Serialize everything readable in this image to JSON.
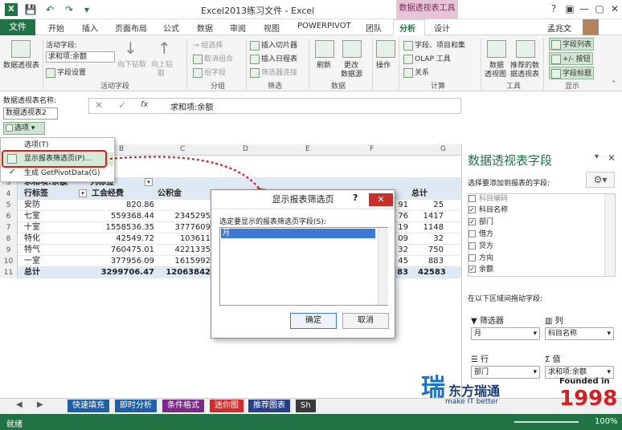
{
  "titlebar": {
    "title": "Excel2013练习文件 - Excel",
    "context_tools": "数据透视表工具",
    "user": "孟兆文"
  },
  "tabs": [
    {
      "label": "文件"
    },
    {
      "label": "开始"
    },
    {
      "label": "插入"
    },
    {
      "label": "页面布局"
    },
    {
      "label": "公式"
    },
    {
      "label": "数据"
    },
    {
      "label": "审阅"
    },
    {
      "label": "视图"
    },
    {
      "label": "POWERPIVOT"
    },
    {
      "label": "团队"
    },
    {
      "label": "分析"
    },
    {
      "label": "设计"
    }
  ],
  "ribbon": {
    "pivot_table_btn": "数据透视表",
    "active_field_label": "活动字段:",
    "active_field_value": "求和项:余额",
    "field_settings": "字段设置",
    "drill_down": "向下钻取",
    "drill_up": "向上钻",
    "drill_up2": "取",
    "group_active_field": "活动字段",
    "group_selection": "→ 组选择",
    "ungroup": "取消组合",
    "group_field": "组字段",
    "group_group": "分组",
    "insert_slicer": "插入切片器",
    "insert_timeline": "插入日程表",
    "filter_connections": "筛选器连接",
    "group_filter": "筛选",
    "refresh": "刷新",
    "change_source": "更改",
    "change_source2": "数据源",
    "group_data": "数据",
    "actions": "操作",
    "fields_items": "字段、项目和集",
    "olap_tools": "OLAP 工具",
    "relationships": "关系",
    "group_calc": "计算",
    "pivot_chart": "数据",
    "pivot_chart2": "透视图",
    "recommended": "推荐的数",
    "recommended2": "据透视表",
    "group_tools": "工具",
    "field_list": "字段列表",
    "buttons": "+/- 按钮",
    "field_headers": "字段标题",
    "group_show": "显示"
  },
  "pvname": {
    "label": "数据透视表名称:",
    "value": "数据透视表2",
    "options_btn": "选项"
  },
  "formula_bar": {
    "formula": "求和项:余额",
    "fx": "fx"
  },
  "dropdown": {
    "items": [
      {
        "label": "选项(T)"
      },
      {
        "label": "显示报表筛选页(P)..."
      },
      {
        "label": "生成 GetPivotData(G)"
      }
    ]
  },
  "grid": {
    "columns": [
      "B",
      "C",
      "D",
      "E",
      "F",
      "G"
    ],
    "row_labels": [
      "3",
      "4",
      "5",
      "6",
      "7",
      "8",
      "9",
      "10",
      "11"
    ],
    "header_row3": "求和项:余额",
    "header_row3b": "列标签",
    "header_row4": "行标签",
    "header_col1": "工会经费",
    "header_col2": "公积金",
    "header_last": "总计",
    "rows": [
      {
        "label": "安防",
        "c1": "820.86",
        "c2": "",
        "c3": "91",
        "c4": "25"
      },
      {
        "label": "七室",
        "c1": "559368.44",
        "c2": "2345295",
        "c3": "76",
        "c4": "1417"
      },
      {
        "label": "十室",
        "c1": "1558536.35",
        "c2": "3777609",
        "c3": "19",
        "c4": "1148"
      },
      {
        "label": "特化",
        "c1": "42549.72",
        "c2": "103611",
        "c3": "09",
        "c4": "32"
      },
      {
        "label": "特气",
        "c1": "760475.01",
        "c2": "4221335",
        "c3": "32",
        "c4": "750"
      },
      {
        "label": "一室",
        "c1": "377956.09",
        "c2": "1615992",
        "c3": "45",
        "c4": "883"
      },
      {
        "label": "总计",
        "c1": "3299706.47",
        "c2": "12063842",
        "c3": "83",
        "c4": "42583"
      }
    ]
  },
  "dialog": {
    "title": "显示报表筛选页",
    "help": "?",
    "close": "✕",
    "label": "选定要显示的报表筛选页字段(S):",
    "item": "月",
    "ok": "确定",
    "cancel": "取消"
  },
  "panel": {
    "title": "数据透视表字段",
    "subtitle": "选择要添加到报表的字段:",
    "fields": [
      {
        "label": "科目编码",
        "checked": false
      },
      {
        "label": "科目名称",
        "checked": true
      },
      {
        "label": "部门",
        "checked": true
      },
      {
        "label": "借方",
        "checked": false
      },
      {
        "label": "贷方",
        "checked": false
      },
      {
        "label": "方向",
        "checked": false
      },
      {
        "label": "余额",
        "checked": true
      }
    ],
    "drag_label": "在以下区域间拖动字段:",
    "filter_zone": "筛选器",
    "filter_value": "月",
    "column_zone": "列",
    "column_value": "科目名称",
    "row_zone": "行",
    "row_value": "部门",
    "value_zone": "值",
    "value_value": "求和项:余额"
  },
  "sheets": [
    {
      "label": "快速填充",
      "color": "#1f5fa8"
    },
    {
      "label": "即时分析",
      "color": "#1f5fa8"
    },
    {
      "label": "条件格式",
      "color": "#7b2a8a"
    },
    {
      "label": "迷你图",
      "color": "#d12b2b"
    },
    {
      "label": "推荐图表",
      "color": "#2a3f8a"
    },
    {
      "label": "Sh",
      "color": "#3a3a3a"
    }
  ],
  "status": {
    "ready": "就绪",
    "zoom": "100%"
  },
  "logo": {
    "brand": "东方瑞通",
    "slogan": "make IT better",
    "founded": "Founded in",
    "year": "1998"
  }
}
